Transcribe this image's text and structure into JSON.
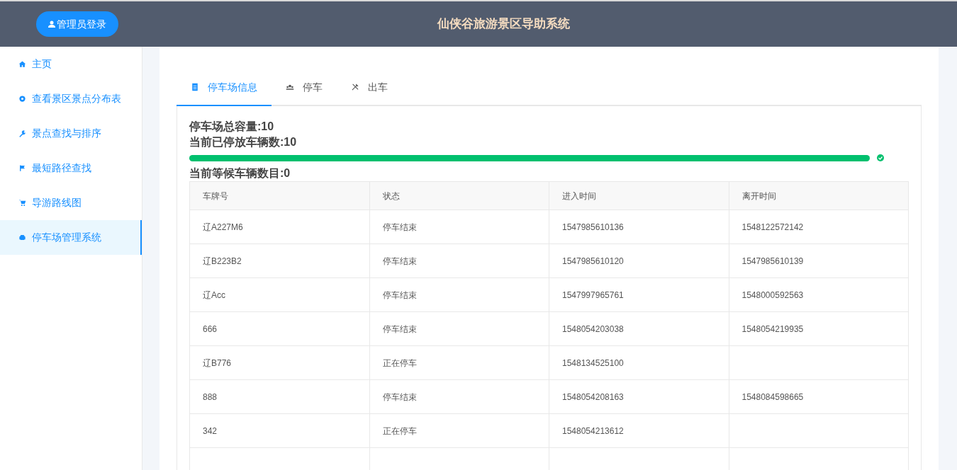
{
  "header": {
    "login_button": "管理员登录",
    "title": "仙侠谷旅游景区导助系统"
  },
  "sidebar": {
    "items": [
      {
        "label": "主页",
        "selected": false
      },
      {
        "label": "查看景区景点分布表",
        "selected": false
      },
      {
        "label": "景点查找与排序",
        "selected": false
      },
      {
        "label": "最短路径查找",
        "selected": false
      },
      {
        "label": "导游路线图",
        "selected": false
      },
      {
        "label": "停车场管理系统",
        "selected": true
      }
    ]
  },
  "tabs": [
    {
      "label": "停车场信息",
      "selected": true
    },
    {
      "label": "停车",
      "selected": false
    },
    {
      "label": "出车",
      "selected": false
    }
  ],
  "info": {
    "capacity": "停车场总容量:10",
    "parked": "当前已停放车辆数:10",
    "progress": {
      "level": 1.0,
      "complete": true
    },
    "waiting": "当前等候车辆数目:0"
  },
  "table": {
    "columns": [
      "车牌号",
      "状态",
      "进入时间",
      "离开时间"
    ],
    "rows": [
      [
        "辽A227M6",
        "停车结束",
        "1547985610136",
        "1548122572142"
      ],
      [
        "辽B223B2",
        "停车结束",
        "1547985610120",
        "1547985610139"
      ],
      [
        "辽Acc",
        "停车结束",
        "1547997965761",
        "1548000592563"
      ],
      [
        "666",
        "停车结束",
        "1548054203038",
        "1548054219935"
      ],
      [
        "辽B776",
        "正在停车",
        "1548134525100",
        ""
      ],
      [
        "888",
        "停车结束",
        "1548054208163",
        "1548084598665"
      ],
      [
        "342",
        "正在停车",
        "1548054213612",
        ""
      ]
    ]
  }
}
